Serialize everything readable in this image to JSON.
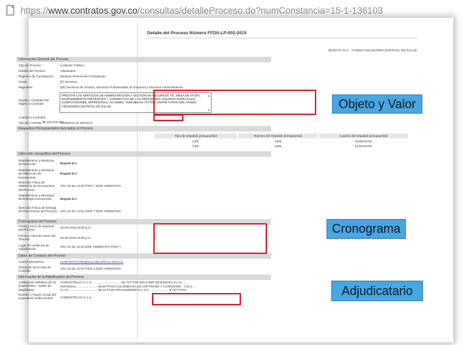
{
  "browser": {
    "url_prefix": "https://",
    "url_host": "www.contratos.gov.co",
    "url_rest": "/consultas/detalleProceso.do?numConstancia=15-1-136103"
  },
  "page": {
    "title": "Detalle del Proceso Número FFDS-LP-002-2015",
    "entity": "BOGOTÁ D.C. - FONDO FINANCIERO DISTRITAL DE SALUD"
  },
  "sections": {
    "general": "Información General del Proceso",
    "presupuestales": "Respaldos Presupuestales Asociados al Proceso",
    "geografica": "Ubicación Geográfica del Proceso",
    "cronograma": "Cronograma del Proceso",
    "contacto": "Datos de Contacto del Proceso",
    "adjudicacion": "Información de la Adjudicación del Proceso"
  },
  "general": {
    "tipo_label": "Tipo de Proceso",
    "tipo_value": "Licitación Pública",
    "estado_label": "Estado del Proceso",
    "estado_value": "Adjudicado",
    "regimen_label": "Régimen de Contratación",
    "regimen_value": "Estatuto General de Contratación",
    "grupo_label": "Grupo",
    "grupo_value": "[F] Servicios",
    "segmento_label": "Segmento",
    "segmento_value": "[80] Servicios de Gestión, Servicios Profesionales de Empresa y Servicios Administrativos",
    "detalle_label": "Detalle y Cantidad del Objeto a Contratar",
    "detalle_value": "PRESTAR LOS SERVICIOS DE ADMINISTRACIÓN Y GESTIÓN DE RECURSOS TIC, MESA DE AYUDA, MANTENIMIENTO PREVENTIVO Y CORRECTIVO DE LOS SERVIDORES, EQUIPOS ESPECIALES, COMPUTADORES, IMPRESORAS, SCANNER, VIDEOBEAM, PLTTER, ENTRE OTROS DEL FONDO FINANCIERO DISTRITAL DE SALUD -",
    "cuantia_label": "Cuantía a Contratar",
    "cuantia_value": "$1.222.075.791",
    "contrato_label": "Tipo de Contrato",
    "contrato_value": "Prestación de Servicios"
  },
  "presupuestal_table": {
    "headers": [
      "Tipo de respaldo presupuestal",
      "Número del respaldo presupuestal",
      "Cuantía del respaldo presupuestal"
    ],
    "rows": [
      [
        "CDP",
        "1608",
        "1222075791"
      ],
      [
        "CDP",
        "1608",
        "1222075791"
      ]
    ]
  },
  "geografica": {
    "depto_ejec_label": "Departamento y Municipio de Ejecución",
    "depto_ejec_value": "Bogotá D.C.",
    "depto_obt_label": "Departamento y Municipio de Obtención de Documentos",
    "depto_obt_value": "Bogotá D.C.",
    "dir_obt_label": "Dirección Física de Obtención de Documentos del Proceso",
    "dir_obt_value": "CRA 32 No 12-81 PISO 7 EDIF ADMINTIVO",
    "depto_ent_label": "Departamento y Municipio de Entrega Documentos",
    "depto_ent_value": "Bogotá D.C.",
    "dir_ent_label": "Dirección Física de Entrega de Documentos del Proceso",
    "dir_ent_value": "CRA 32 No 12-81 PISO 7 EDIF ADMINTIVO"
  },
  "cronograma": {
    "apertura_label": "Fecha y Hora de Apertura del Proceso",
    "apertura_value": "25-03-2015 04:00 p.m.",
    "cierre_label": "Fecha y Hora de Cierre del Proceso",
    "cierre_value": "25-05-2015 04:00 p.m.",
    "lugar_label": "Lugar de Audiencia de Adjudicación",
    "lugar_value": "CRA 32 No 12-81 EDIF ADMINTIVO PISO 7"
  },
  "contacto": {
    "correo_label": "Correo Electrónico",
    "correo_value": "CONTRATACION@SALUDCAPITAL.GOV.CO",
    "sala_label": "Ubicación de la Sala de Consulta",
    "sala_value": "CRA 32 No 12-81 PISO 6 EDIF ADMINTIVO"
  },
  "adjudicacion": {
    "calificacion_label": "Calificación definitiva de los proponentes - Orden de elegibilidad",
    "calificacion_line1": "COMSISTELCO S.A.S. ................................ 99.74 PTOS DELCOMP INGENIERIA S.A.S. ...",
    "calificacion_line2": "SISTEMAS ........................ 98.50 PTOS COLOMBIANA DE SOFTWARE Y HARDWARE - COLS ...",
    "calificacion_line3": "S.A.S. ................................ 98.13 PTOS PROCIBERNETICA S.A. ..................... 97.87 PTOS",
    "nombre_label": "Nombre o Razón Social del proponente seleccionado",
    "nombre_value": "COMSISTELCO S.A.S."
  },
  "callouts": {
    "objeto": "Objeto y Valor",
    "cronograma": "Cronograma",
    "adjudicatario": "Adjudicatario"
  },
  "colors": {
    "highlight_red": "#e01b24",
    "callout_blue": "#49a6e0",
    "section_gray": "#d9d9d9"
  }
}
